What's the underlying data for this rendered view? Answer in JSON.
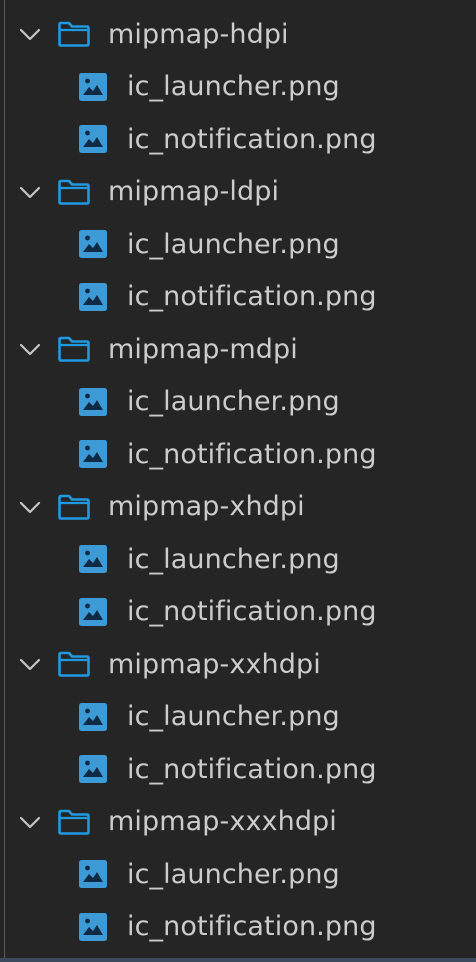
{
  "icons": {
    "chevron": "chevron-down-icon",
    "folder": "folder-icon",
    "file": "image-file-icon"
  },
  "colors": {
    "background": "#252526",
    "text": "#cccccc",
    "folder_icon": "#1f9ae0",
    "image_icon": "#3c9ad7",
    "indent_guide": "#585858"
  },
  "tree": {
    "folders": [
      {
        "label": "mipmap-hdpi",
        "files": [
          {
            "label": "ic_launcher.png"
          },
          {
            "label": "ic_notification.png"
          }
        ]
      },
      {
        "label": "mipmap-ldpi",
        "files": [
          {
            "label": "ic_launcher.png"
          },
          {
            "label": "ic_notification.png"
          }
        ]
      },
      {
        "label": "mipmap-mdpi",
        "files": [
          {
            "label": "ic_launcher.png"
          },
          {
            "label": "ic_notification.png"
          }
        ]
      },
      {
        "label": "mipmap-xhdpi",
        "files": [
          {
            "label": "ic_launcher.png"
          },
          {
            "label": "ic_notification.png"
          }
        ]
      },
      {
        "label": "mipmap-xxhdpi",
        "files": [
          {
            "label": "ic_launcher.png"
          },
          {
            "label": "ic_notification.png"
          }
        ]
      },
      {
        "label": "mipmap-xxxhdpi",
        "files": [
          {
            "label": "ic_launcher.png"
          },
          {
            "label": "ic_notification.png"
          }
        ]
      }
    ]
  }
}
